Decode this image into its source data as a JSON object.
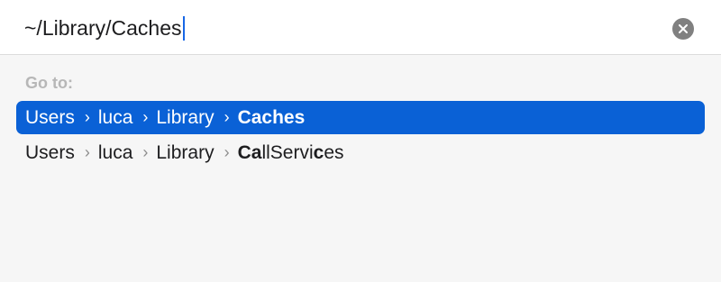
{
  "search": {
    "value": "~/Library/Caches"
  },
  "results": {
    "header": "Go to:",
    "separator": "›",
    "items": [
      {
        "segments": [
          "Users",
          "luca",
          "Library"
        ],
        "last_parts": [
          {
            "text": "Caches",
            "bold": true
          }
        ],
        "selected": true
      },
      {
        "segments": [
          "Users",
          "luca",
          "Library"
        ],
        "last_parts": [
          {
            "text": "Ca",
            "bold": true
          },
          {
            "text": "llServi",
            "bold": false
          },
          {
            "text": "c",
            "bold": true
          },
          {
            "text": "es",
            "bold": false
          }
        ],
        "selected": false
      }
    ]
  },
  "colors": {
    "accent": "#0a61d6",
    "caret": "#1767e6"
  }
}
